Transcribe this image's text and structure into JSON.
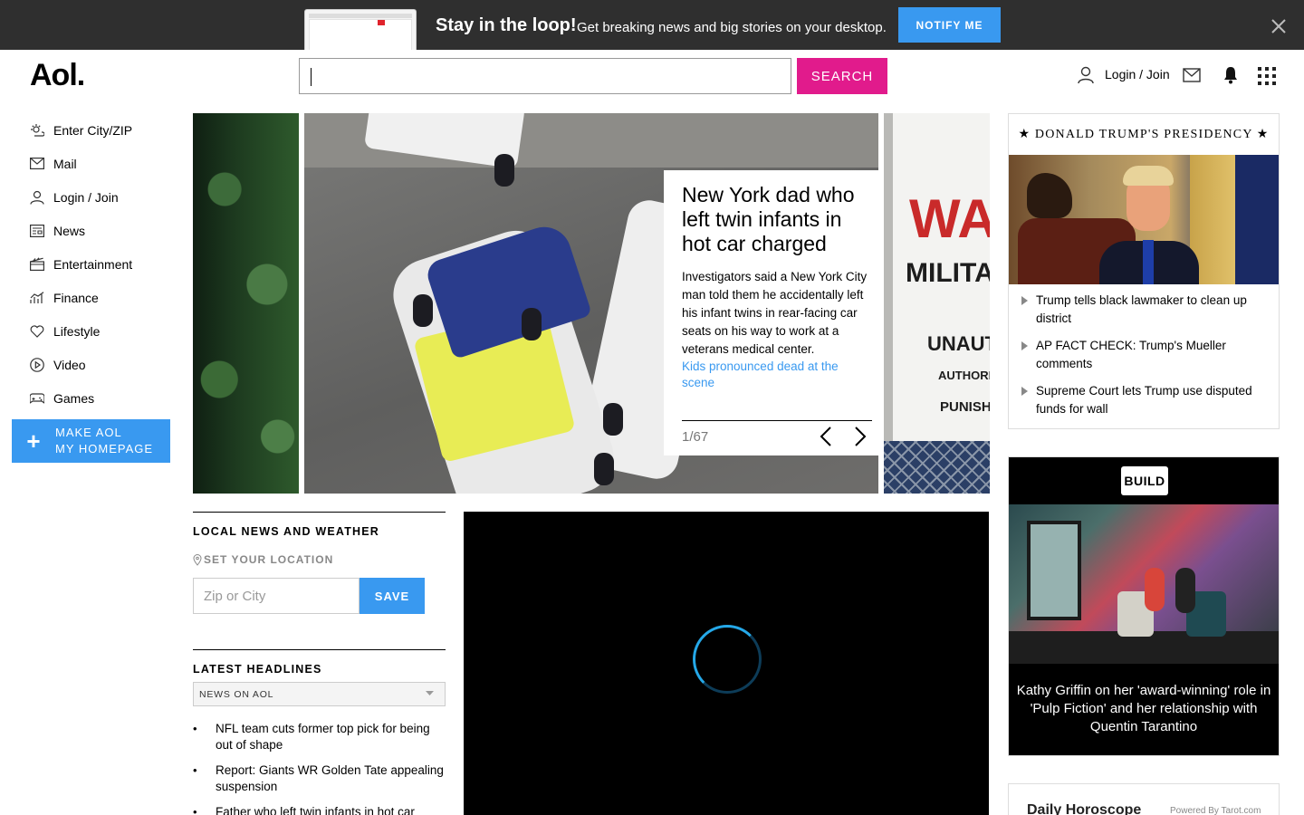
{
  "promo": {
    "title": "Stay in the loop!",
    "subtitle": "Get breaking news and big stories on your desktop.",
    "notify_label": "NOTIFY ME"
  },
  "header": {
    "logo": "Aol.",
    "search_button": "SEARCH",
    "login_label": "Login / Join"
  },
  "nav": {
    "items": [
      {
        "label": "Enter City/ZIP",
        "icon": "weather-icon"
      },
      {
        "label": "Mail",
        "icon": "mail-icon"
      },
      {
        "label": "Login / Join",
        "icon": "user-icon"
      },
      {
        "label": "News",
        "icon": "news-icon"
      },
      {
        "label": "Entertainment",
        "icon": "clapper-icon"
      },
      {
        "label": "Finance",
        "icon": "chart-icon"
      },
      {
        "label": "Lifestyle",
        "icon": "heart-icon"
      },
      {
        "label": "Video",
        "icon": "play-icon"
      },
      {
        "label": "Games",
        "icon": "gamepad-icon"
      }
    ],
    "make_homepage_line1": "MAKE AOL",
    "make_homepage_line2": "MY HOMEPAGE"
  },
  "carousel": {
    "title": "New York dad who left twin infants in hot car charged",
    "description": "Investigators said a New York City man told them he accidentally left his infant twins in rear-facing car seats on his way to work at a veterans medical center.",
    "link": "Kids pronounced dead at the scene",
    "counter": "1/67",
    "side_sign_letter": "WA",
    "side_sign_line1": "MILITA",
    "side_sign_line2": "UNAUT",
    "side_sign_line3": "AUTHORI",
    "side_sign_line4": "PUNISH"
  },
  "local": {
    "title": "LOCAL NEWS AND WEATHER",
    "set_location": "SET YOUR LOCATION",
    "zip_placeholder": "Zip or City",
    "save_label": "SAVE"
  },
  "latest": {
    "title": "LATEST HEADLINES",
    "source": "NEWS ON AOL",
    "headlines": [
      "NFL team cuts former top pick for being out of shape",
      "Report: Giants WR Golden Tate appealing suspension",
      "Father who left twin infants in hot car"
    ]
  },
  "trump": {
    "heading": "★ DONALD TRUMP'S PRESIDENCY ★",
    "items": [
      "Trump tells black lawmaker to clean up district",
      "AP FACT CHECK: Trump's Mueller comments",
      "Supreme Court lets Trump use disputed funds for wall"
    ]
  },
  "build": {
    "logo": "BUILD",
    "caption": "Kathy Griffin on her 'award-winning' role in 'Pulp Fiction' and her relationship with Quentin Tarantino"
  },
  "horoscope": {
    "title": "Daily Horoscope",
    "powered": "Powered By Tarot.com"
  }
}
